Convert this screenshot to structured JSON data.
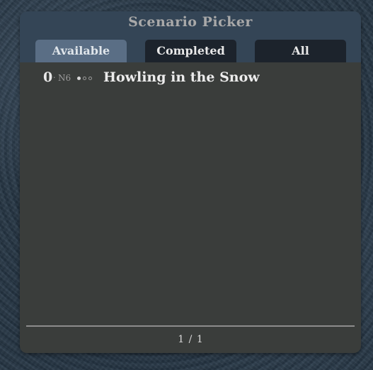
{
  "panel": {
    "title": "Scenario Picker"
  },
  "tabs": [
    {
      "label": "Available",
      "active": true
    },
    {
      "label": "Completed",
      "active": false
    },
    {
      "label": "All",
      "active": false
    }
  ],
  "scenarios": [
    {
      "number": "0",
      "code": "N6",
      "progress": {
        "completed": 1,
        "total": 3
      },
      "name": "Howling in the Snow"
    }
  ],
  "pagination": {
    "current": "1",
    "separator": "/",
    "total": "1"
  },
  "colors": {
    "panel_bg": "#3a3d3b",
    "header_bg": "#344556",
    "active_tab": "#5a6e85",
    "inactive_tab": "#1c232c",
    "text": "#ececec",
    "muted_text": "#9b9b9b"
  }
}
